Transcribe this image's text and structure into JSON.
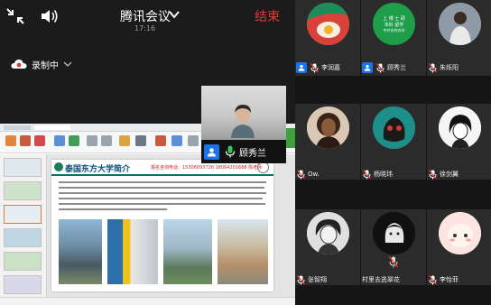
{
  "header": {
    "title": "腾讯会议",
    "time": "17:16",
    "end_label": "结束"
  },
  "recording": {
    "label": "录制中"
  },
  "self_view": {
    "name": "顾秀兰"
  },
  "shared_screen": {
    "slide_title": "泰国东方大学简介",
    "contact_text": "报名咨询电话：15306093726 18064201688 陈老师"
  },
  "participants": [
    {
      "name": "李润嘉",
      "host": true
    },
    {
      "name": "顾秀兰",
      "host": true
    },
    {
      "name": "朱烁阳",
      "host": false
    },
    {
      "name": "Ow.",
      "host": false
    },
    {
      "name": "杨晓玮",
      "host": false
    },
    {
      "name": "徐剑翼",
      "host": false
    },
    {
      "name": "张智翔",
      "host": false
    },
    {
      "name": "村里去逃翠花",
      "host": false
    },
    {
      "name": "李怡菲",
      "host": false
    }
  ],
  "avatar_badge_text": {
    "line1": "上 博 士 硕",
    "line2": "本科 留学",
    "line3": "中外合作办学"
  },
  "colors": {
    "end_red": "#e53935",
    "badge_blue": "#1a73e8",
    "mic_green": "#34c759",
    "mute_red": "#ff3b30",
    "record_red": "#e53935"
  },
  "icons": [
    "grid-icon",
    "speaker-icon",
    "chevron-down-icon",
    "cloud-record-icon",
    "mic-icon",
    "mic-muted-icon",
    "user-icon"
  ]
}
